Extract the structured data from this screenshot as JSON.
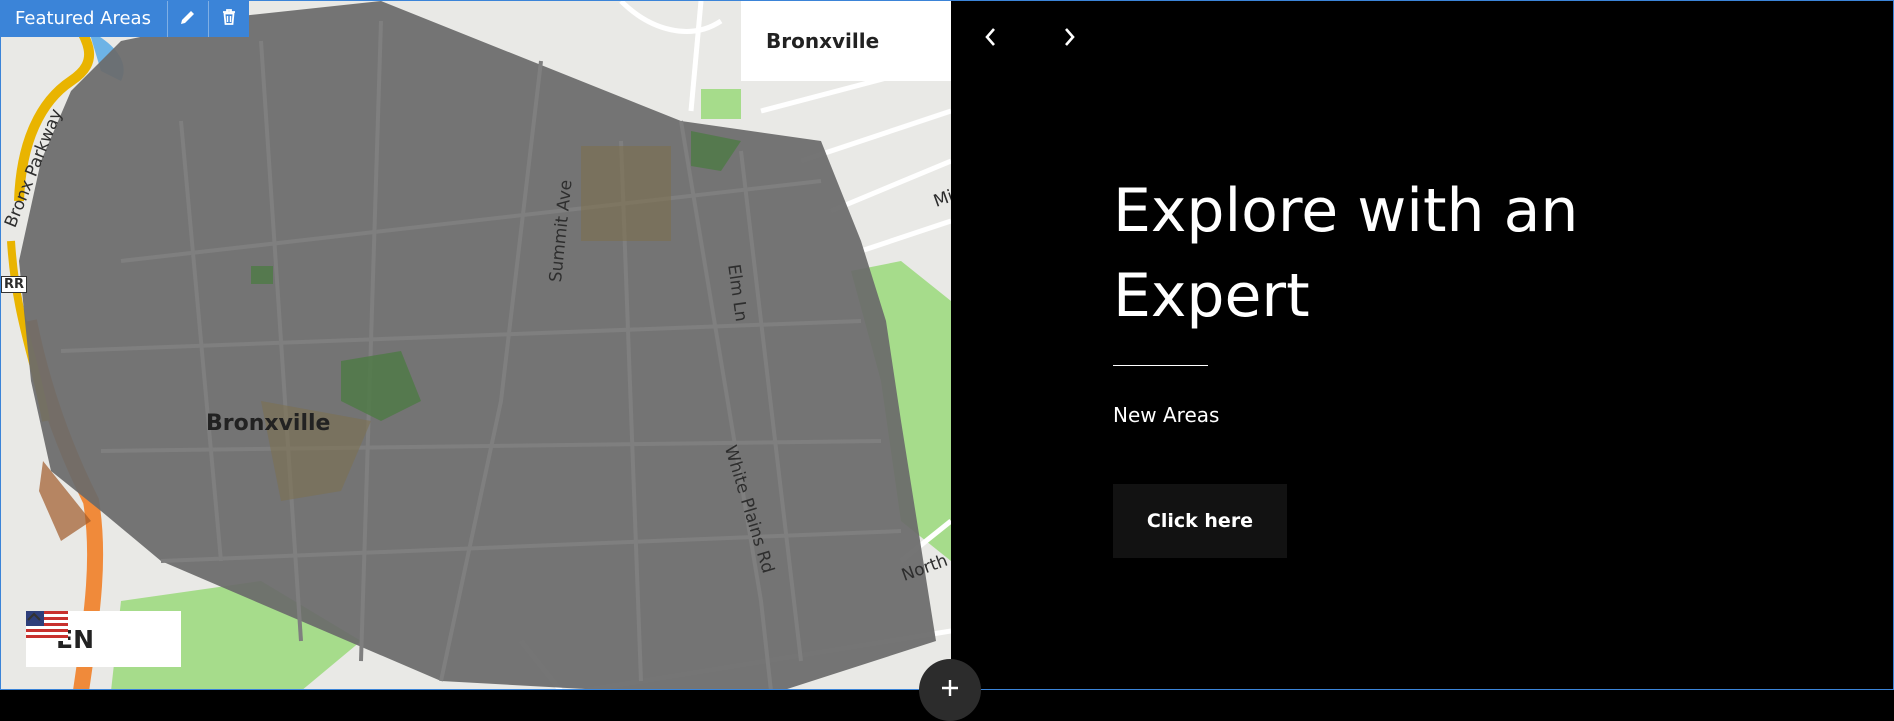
{
  "toolbar": {
    "label": "Featured Areas",
    "edit_icon": "pencil-icon",
    "delete_icon": "trash-icon",
    "color": "#3b84d8"
  },
  "map": {
    "selected_area": "Bronxville",
    "labels": {
      "place": "Bronxville",
      "summit": "Summit Ave",
      "elm": "Elm Ln",
      "white_plains": "White Plains Rd",
      "bronx_parkway": "Bronx Parkway",
      "north": "North",
      "mi": "Mi",
      "rr": "RR"
    },
    "overlay_color": "#5a5a5a"
  },
  "language": {
    "code": "EN",
    "flag_icon": "us-flag-icon",
    "chevron_icon": "chevron-up-icon"
  },
  "slider": {
    "prev_icon": "chevron-left-icon",
    "next_icon": "chevron-right-icon",
    "headline": "Explore with an Expert",
    "subtitle": "New Areas",
    "button_label": "Click here"
  },
  "add_icon": "plus-icon"
}
